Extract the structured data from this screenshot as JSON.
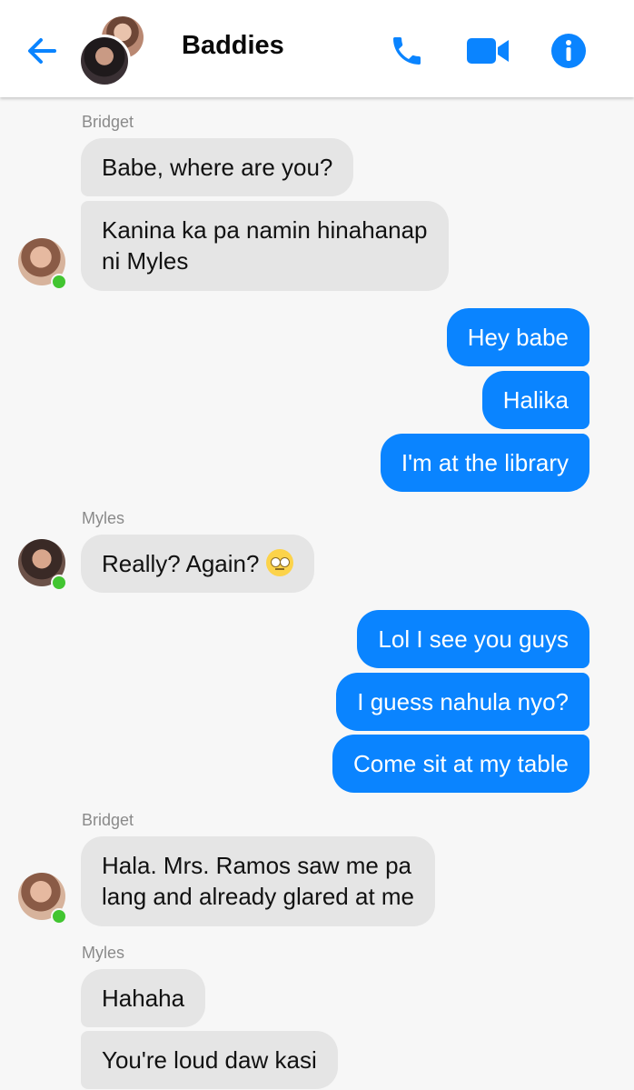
{
  "header": {
    "title": "Baddies",
    "back_icon": "arrow-left-icon",
    "call_icon": "phone-icon",
    "video_icon": "video-camera-icon",
    "info_icon": "info-icon",
    "accent": "#0a84ff"
  },
  "colors": {
    "sent_bubble": "#0a84ff",
    "received_bubble": "#e5e5e5",
    "online": "#42c531"
  },
  "messages": [
    {
      "sender": "Bridget",
      "text": "Babe, where are you?"
    },
    {
      "text": "Kanina ka pa namin hinahanap"
    },
    {
      "text": "ni Myles"
    },
    {
      "text": "Hey babe"
    },
    {
      "text": "Halika"
    },
    {
      "text": "I'm at the library"
    },
    {
      "sender": "Myles",
      "text": "Really? Again?",
      "emoji": "face-with-rolling-eyes"
    },
    {
      "text": "Lol I see you guys"
    },
    {
      "text": "I guess nahula nyo?"
    },
    {
      "text": "Come sit at my table"
    },
    {
      "sender": "Bridget",
      "text": "Hala. Mrs. Ramos saw me pa"
    },
    {
      "text": "lang and already glared at me"
    },
    {
      "sender": "Myles",
      "text": "Hahaha"
    },
    {
      "text": "You're loud daw kasi"
    }
  ]
}
